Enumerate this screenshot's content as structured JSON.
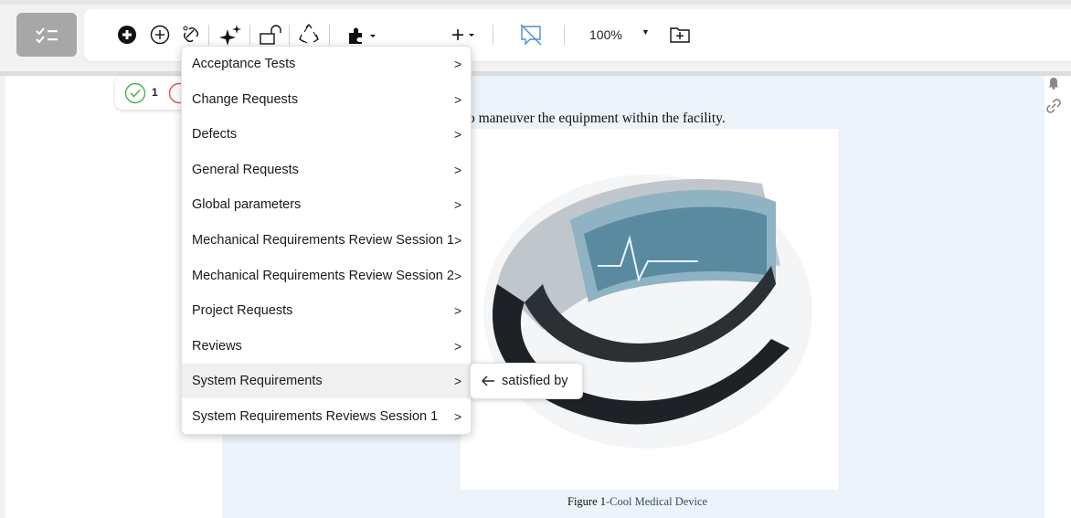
{
  "toolbar": {
    "zoom": "100%",
    "icons": [
      "checklist-icon",
      "add-filled-icon",
      "add-outline-icon",
      "link-icon",
      "sparkle-icon",
      "unlock-icon",
      "recycle-icon",
      "puzzle-icon",
      "plus-icon",
      "comment-off-icon",
      "zoom-dropdown-icon",
      "add-box-icon"
    ]
  },
  "status": {
    "passed_count": "1"
  },
  "document": {
    "text_line": "o maneuver the equipment within the facility.",
    "caption_label": "Figure 1",
    "caption_rest": "-Cool Medical Device"
  },
  "menu": {
    "items": [
      {
        "label": "Acceptance Tests"
      },
      {
        "label": "Change Requests"
      },
      {
        "label": "Defects"
      },
      {
        "label": "General Requests"
      },
      {
        "label": "Global parameters"
      },
      {
        "label": "Mechanical Requirements Review Session 1"
      },
      {
        "label": "Mechanical Requirements Review Session 2"
      },
      {
        "label": "Project Requests"
      },
      {
        "label": "Reviews"
      },
      {
        "label": "System Requirements"
      },
      {
        "label": "System Requirements Reviews Session 1"
      }
    ],
    "chevron": ">",
    "active_index": 9
  },
  "submenu": {
    "label": "satisfied by"
  },
  "colors": {
    "accent_gray": "#a7a7a7",
    "doc_blue": "#ecf3fa",
    "pass_green": "#4caf50",
    "fail_red": "#d9534f",
    "comment_blue": "#4a90d9"
  }
}
